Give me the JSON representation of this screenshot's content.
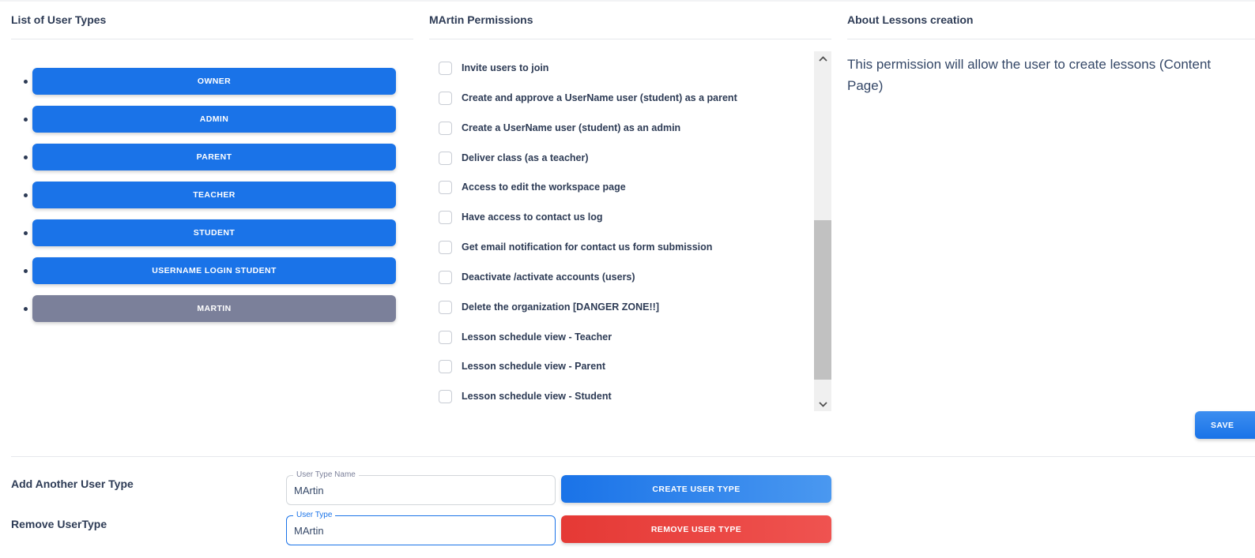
{
  "colors": {
    "primary": "#1a73e8",
    "selected": "#7b809a",
    "danger": "#e53935",
    "text": "#2d3b55"
  },
  "user_types_panel": {
    "title": "List of User Types",
    "types": [
      {
        "label": "OWNER",
        "selected": false
      },
      {
        "label": "ADMIN",
        "selected": false
      },
      {
        "label": "PARENT",
        "selected": false
      },
      {
        "label": "TEACHER",
        "selected": false
      },
      {
        "label": "STUDENT",
        "selected": false
      },
      {
        "label": "USERNAME LOGIN STUDENT",
        "selected": false
      },
      {
        "label": "MARTIN",
        "selected": true
      }
    ]
  },
  "permissions_panel": {
    "title": "MArtin Permissions",
    "items": [
      {
        "label": "Invite users to join",
        "checked": false
      },
      {
        "label": "Create and approve a UserName user (student) as a parent",
        "checked": false
      },
      {
        "label": "Create a UserName user (student) as an admin",
        "checked": false
      },
      {
        "label": "Deliver class (as a teacher)",
        "checked": false
      },
      {
        "label": "Access to edit the workspace page",
        "checked": false
      },
      {
        "label": "Have access to contact us log",
        "checked": false
      },
      {
        "label": "Get email notification for contact us form submission",
        "checked": false
      },
      {
        "label": "Deactivate /activate accounts (users)",
        "checked": false
      },
      {
        "label": "Delete the organization [DANGER ZONE!!]",
        "checked": false
      },
      {
        "label": "Lesson schedule view - Teacher",
        "checked": false
      },
      {
        "label": "Lesson schedule view - Parent",
        "checked": false
      },
      {
        "label": "Lesson schedule view - Student",
        "checked": false
      }
    ],
    "scroll_up_icon": "chevron-up-icon",
    "scroll_down_icon": "chevron-down-icon"
  },
  "about_panel": {
    "title": "About Lessons creation",
    "description": "This permission will allow the user to create lessons (Content Page)",
    "save_label": "SAVE"
  },
  "add_form": {
    "label": "Add Another User Type",
    "field_legend": "User Type Name",
    "field_value": "MArtin",
    "button_label": "CREATE USER TYPE"
  },
  "remove_form": {
    "label": "Remove UserType",
    "field_legend": "User Type",
    "field_value": "MArtin",
    "button_label": "REMOVE USER TYPE"
  }
}
